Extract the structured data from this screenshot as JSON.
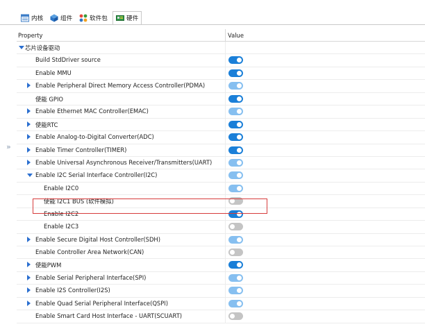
{
  "tabs": [
    {
      "label": "内核",
      "icon": "kernel-icon",
      "active": false
    },
    {
      "label": "组件",
      "icon": "component-icon",
      "active": false
    },
    {
      "label": "软件包",
      "icon": "package-icon",
      "active": false
    },
    {
      "label": "硬件",
      "icon": "hardware-icon",
      "active": true
    }
  ],
  "table": {
    "col_property": "Property",
    "col_value": "Value"
  },
  "rows": [
    {
      "label": "芯片设备驱动",
      "level": 0,
      "expander": "down",
      "toggle": null
    },
    {
      "label": "Build StdDriver source",
      "level": 1,
      "expander": null,
      "toggle": "on"
    },
    {
      "label": "Enable MMU",
      "level": 1,
      "expander": null,
      "toggle": "on"
    },
    {
      "label": "Enable Peripheral Direct Memory Access Controller(PDMA)",
      "level": 1,
      "expander": "right",
      "toggle": "on-light"
    },
    {
      "label": "使能 GPIO",
      "level": 1,
      "expander": null,
      "toggle": "on"
    },
    {
      "label": "Enable Ethernet MAC Controller(EMAC)",
      "level": 1,
      "expander": "right",
      "toggle": "on-light"
    },
    {
      "label": "使能RTC",
      "level": 1,
      "expander": "right",
      "toggle": "on"
    },
    {
      "label": "Enable Analog-to-Digital Converter(ADC)",
      "level": 1,
      "expander": "right",
      "toggle": "on"
    },
    {
      "label": "Enable Timer Controller(TIMER)",
      "level": 1,
      "expander": "right",
      "toggle": "on"
    },
    {
      "label": "Enable Universal Asynchronous Receiver/Transmitters(UART)",
      "level": 1,
      "expander": "right",
      "toggle": "on-light"
    },
    {
      "label": "Enable I2C Serial Interface Controller(I2C)",
      "level": 1,
      "expander": "down",
      "toggle": "on-light"
    },
    {
      "label": "Enable I2C0",
      "level": 2,
      "expander": null,
      "toggle": "on-light"
    },
    {
      "label": "使能 I2C1 BUS (软件模拟)",
      "level": 2,
      "expander": null,
      "toggle": "off"
    },
    {
      "label": "Enable I2C2",
      "level": 2,
      "expander": null,
      "toggle": "on",
      "highlighted": true
    },
    {
      "label": "Enable I2C3",
      "level": 2,
      "expander": null,
      "toggle": "off"
    },
    {
      "label": "Enable Secure Digital Host Controller(SDH)",
      "level": 1,
      "expander": "right",
      "toggle": "on-light"
    },
    {
      "label": "Enable Controller Area Network(CAN)",
      "level": 1,
      "expander": null,
      "toggle": "off"
    },
    {
      "label": "使能PWM",
      "level": 1,
      "expander": "right",
      "toggle": "on"
    },
    {
      "label": "Enable Serial Peripheral Interface(SPI)",
      "level": 1,
      "expander": "right",
      "toggle": "on-light"
    },
    {
      "label": "Enable I2S Controller(I2S)",
      "level": 1,
      "expander": "right",
      "toggle": "on-light"
    },
    {
      "label": "Enable Quad Serial Peripheral Interface(QSPI)",
      "level": 1,
      "expander": "right",
      "toggle": "on-light"
    },
    {
      "label": "Enable Smart Card Host Interface - UART(SCUART)",
      "level": 1,
      "expander": null,
      "toggle": "off"
    }
  ],
  "side_expand": "»",
  "colors": {
    "toggle_on": "#1a7fd8",
    "toggle_on_light": "#86bff0",
    "toggle_off": "#c4c4c4",
    "expander": "#2b6fd0",
    "highlight_border": "#d63b3b"
  }
}
